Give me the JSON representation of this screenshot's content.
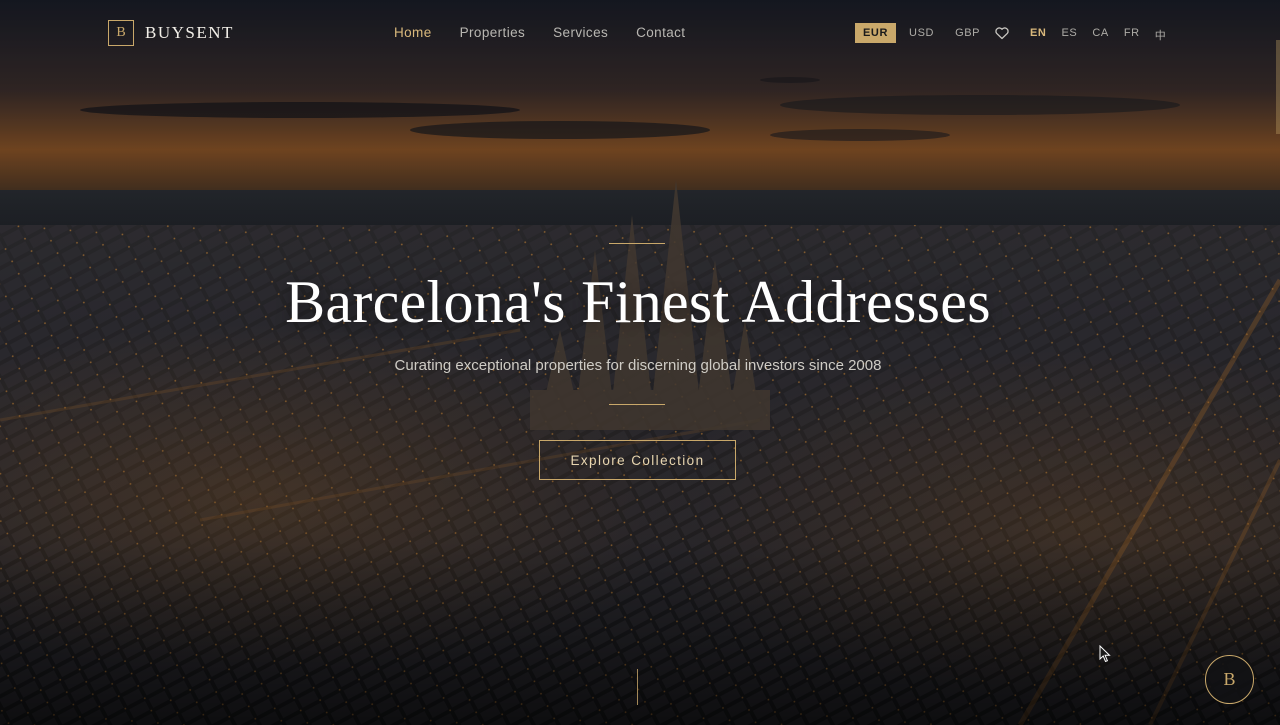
{
  "brand": {
    "mark": "B",
    "name": "BUYSENT",
    "accent_color": "#c9a86a"
  },
  "nav": {
    "items": [
      {
        "label": "Home",
        "active": true
      },
      {
        "label": "Properties",
        "active": false
      },
      {
        "label": "Services",
        "active": false
      },
      {
        "label": "Contact",
        "active": false
      }
    ]
  },
  "currency": {
    "options": [
      "EUR",
      "USD",
      "GBP"
    ],
    "selected": "EUR"
  },
  "favorites": {
    "icon": "heart-icon"
  },
  "languages": {
    "options": [
      "EN",
      "ES",
      "CA",
      "FR",
      "中"
    ],
    "selected": "EN"
  },
  "hero": {
    "title": "Barcelona's Finest Addresses",
    "subtitle": "Curating exceptional properties for discerning global investors since 2008",
    "cta_label": "Explore Collection",
    "background": "aerial-city-dusk"
  },
  "floating_button": {
    "label": "B"
  }
}
